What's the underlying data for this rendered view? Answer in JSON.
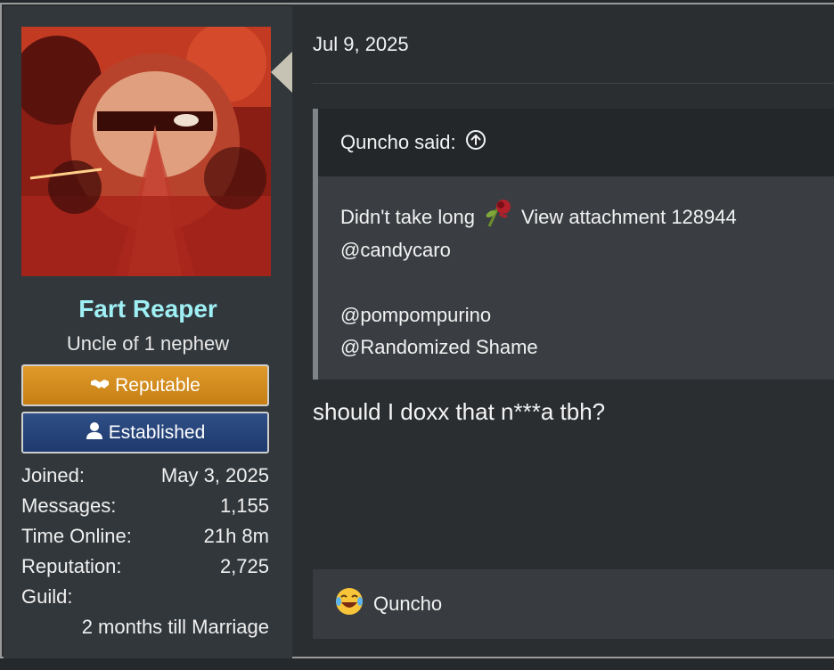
{
  "user": {
    "name": "Fart Reaper",
    "title": "Uncle of 1 nephew",
    "banners": {
      "reputable": "Reputable",
      "established": "Established"
    },
    "stats": {
      "joined_label": "Joined:",
      "joined_value": "May 3, 2025",
      "messages_label": "Messages:",
      "messages_value": "1,155",
      "time_online_label": "Time Online:",
      "time_online_value": "21h 8m",
      "reputation_label": "Reputation:",
      "reputation_value": "2,725",
      "guild_label": "Guild:",
      "guild_value": "2 months till Marriage"
    },
    "colors": {
      "name": "#9ff0f5",
      "reputable": "#d98f1f",
      "established": "#2a4a80"
    }
  },
  "post": {
    "date": "Jul 9, 2025",
    "quote": {
      "author": "Quncho said:",
      "line1_a": "Didn't take long",
      "line1_b": "View attachment 128944",
      "line2": "@candycaro",
      "line4": "@pompompurino",
      "line5": "@Randomized Shame",
      "emoji_icon": "wilted-rose-icon"
    },
    "message": "should I doxx that n***a tbh?",
    "reaction": {
      "user": "Quncho",
      "emoji_icon": "laughing-crying-icon"
    }
  }
}
